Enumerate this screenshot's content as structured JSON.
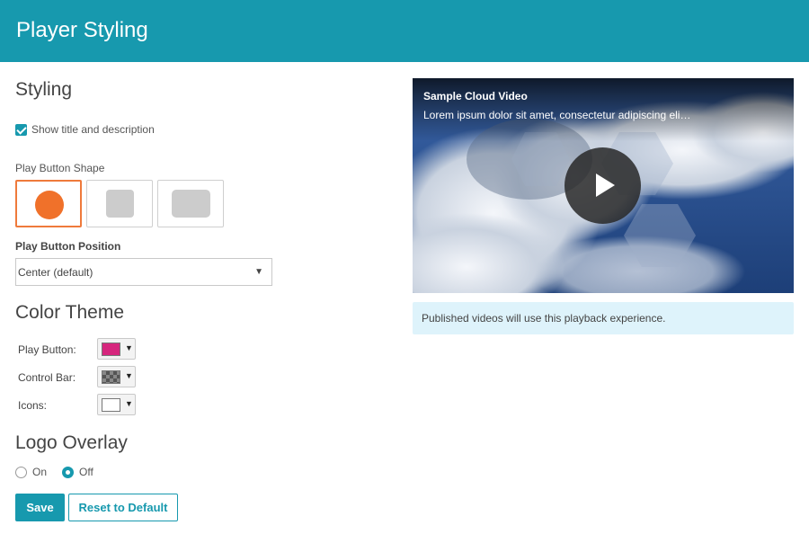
{
  "header": {
    "title": "Player Styling"
  },
  "styling": {
    "heading": "Styling",
    "show_title_label": "Show title and description",
    "shape_label": "Play Button Shape",
    "shapes": [
      {
        "name": "circle",
        "selected": true
      },
      {
        "name": "rounded-square",
        "selected": false
      },
      {
        "name": "rounded-rectangle",
        "selected": false
      }
    ],
    "position_label": "Play Button Position",
    "position_value": "Center (default)"
  },
  "color_theme": {
    "heading": "Color Theme",
    "items": [
      {
        "label": "Play Button:",
        "color": "#d6267d"
      },
      {
        "label": "Control Bar:",
        "color": "transparent-checker"
      },
      {
        "label": "Icons:",
        "color": "#ffffff"
      }
    ]
  },
  "logo_overlay": {
    "heading": "Logo Overlay",
    "on_label": "On",
    "off_label": "Off",
    "selected": "Off"
  },
  "actions": {
    "save_label": "Save",
    "reset_label": "Reset to Default"
  },
  "preview": {
    "video_title": "Sample Cloud Video",
    "video_description": "Lorem ipsum dolor sit amet, consectetur adipiscing eli…",
    "info_text": "Published videos will use this playback experience."
  },
  "colors": {
    "accent": "#1799ae",
    "selected_border": "#ef7a3b",
    "play_shape": "#f0712a"
  }
}
